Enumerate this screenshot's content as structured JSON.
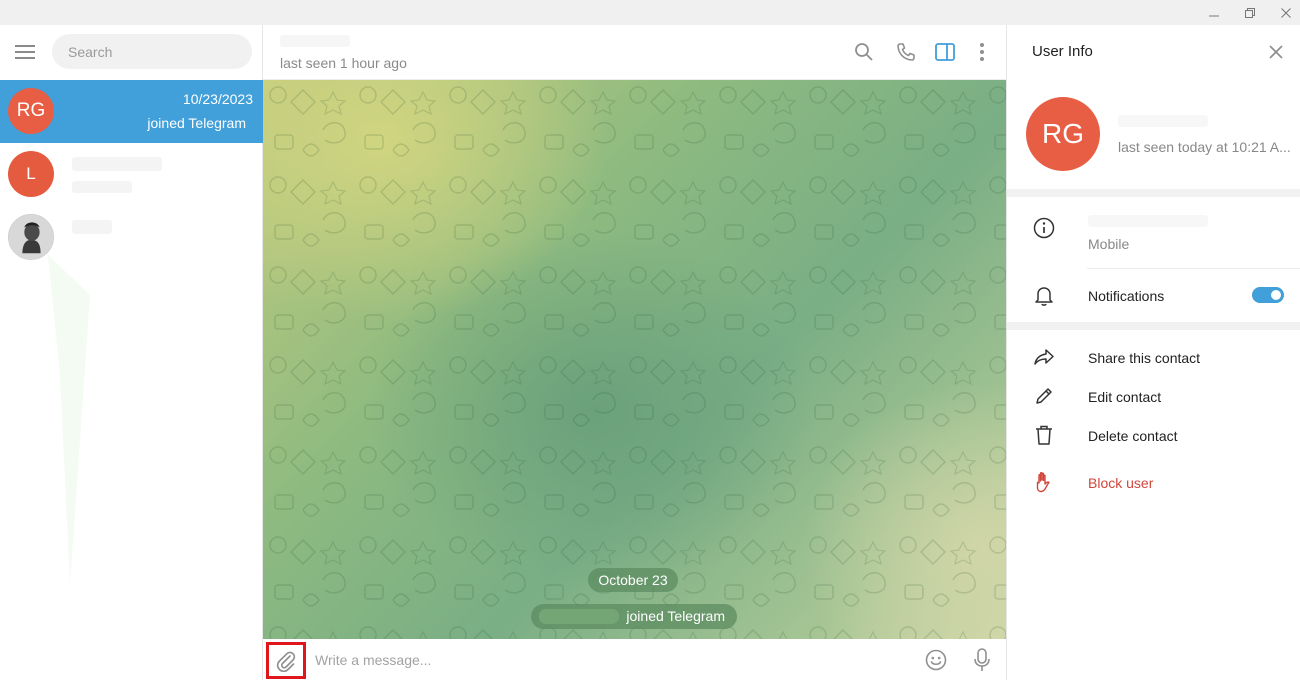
{
  "window": {
    "controls": [
      "minimize-icon",
      "restore-icon",
      "close-icon"
    ]
  },
  "sidebar": {
    "search_placeholder": "Search",
    "chats": [
      {
        "avatar_initials": "RG",
        "date": "10/23/2023",
        "preview": "joined Telegram",
        "active": true
      },
      {
        "avatar_initials": "L",
        "active": false
      },
      {
        "avatar": "photo",
        "active": false
      }
    ]
  },
  "chat": {
    "status": "last seen 1 hour ago",
    "date_separator": "October 23",
    "service_message": "joined Telegram",
    "composer_placeholder": "Write a message...",
    "header_icons": [
      "search-icon",
      "phone-icon",
      "sidebar-toggle-icon",
      "more-vertical-icon"
    ]
  },
  "info": {
    "title": "User Info",
    "avatar_initials": "RG",
    "status": "last seen today at 10:21 A...",
    "phone_label": "Mobile",
    "notifications_label": "Notifications",
    "notifications_on": true,
    "actions": {
      "share": "Share this contact",
      "edit": "Edit contact",
      "delete": "Delete contact",
      "block": "Block user"
    }
  },
  "colors": {
    "accent": "#419fd9",
    "avatar_red": "#e85e45",
    "danger": "#d0463c",
    "highlight_box": "#e0161c"
  }
}
